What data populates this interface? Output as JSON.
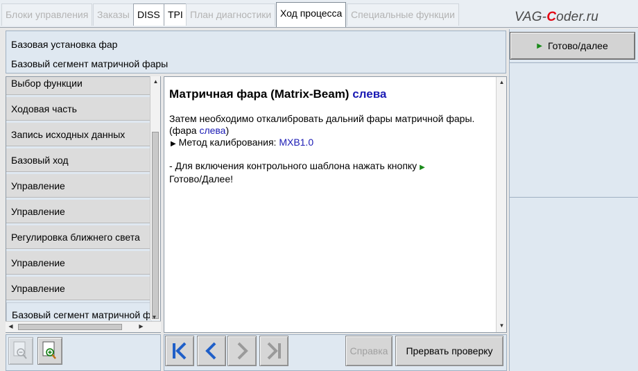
{
  "tabs": [
    {
      "label": "Блоки управления",
      "state": "disabled"
    },
    {
      "label": "Заказы",
      "state": "disabled"
    },
    {
      "label": "DISS",
      "state": "enabled"
    },
    {
      "label": "TPI",
      "state": "enabled"
    },
    {
      "label": "План диагностики",
      "state": "disabled"
    },
    {
      "label": "Ход процесса",
      "state": "active"
    },
    {
      "label": "Специальные функции",
      "state": "disabled"
    }
  ],
  "watermark": {
    "part1": "VAG-",
    "part2": "C",
    "part3": "oder.ru"
  },
  "header": {
    "line1": "Базовая установка фар",
    "line2": "Базовый сегмент матричной фары"
  },
  "right_panel": {
    "ready_label": "Готово/далее"
  },
  "function_list": [
    {
      "label": "Выбор функции"
    },
    {
      "label": "Ходовая часть"
    },
    {
      "label": "Запись исходных данных"
    },
    {
      "label": "Базовый ход"
    },
    {
      "label": "Управление"
    },
    {
      "label": "Управление"
    },
    {
      "label": "Регулировка ближнего света"
    },
    {
      "label": "Управление"
    },
    {
      "label": "Управление"
    },
    {
      "label": "Базовый сегмент матричной фары"
    }
  ],
  "content": {
    "title_main": "Матричная фара (Matrix-Beam)",
    "title_side": "слева",
    "text_line1": "Затем необходимо откалибровать дальний фары матричной фары.",
    "text_line2_prefix": "(фара",
    "text_line2_side": "слева",
    "text_line2_suffix": ")",
    "method_label": "Метод калибрования:",
    "method_value": "MXB1.0",
    "hint_prefix": "- Для включения контрольного шаблона нажать кнопку",
    "hint_suffix": "Готово/Далее!"
  },
  "bottom": {
    "help_label": "Справка",
    "abort_label": "Прервать проверку"
  },
  "colors": {
    "accent_blue": "#1a1ab4",
    "ready_arrow_green": "#1a8a1a",
    "watermark_red": "#e30613",
    "panel_bg": "#dfe8f1"
  },
  "icons": [
    "zoom-out-icon",
    "zoom-in-icon",
    "first-step-icon",
    "previous-step-icon",
    "next-step-icon",
    "last-step-icon",
    "play-triangle-icon"
  ]
}
